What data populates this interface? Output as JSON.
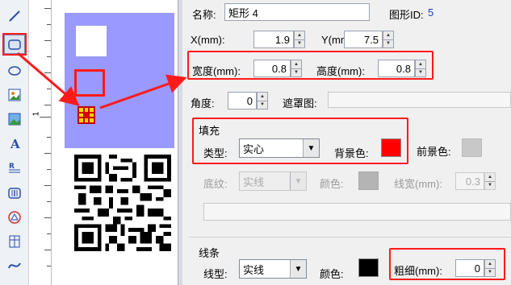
{
  "toolbar": {
    "tools": [
      {
        "icon": "line-icon"
      },
      {
        "icon": "rectangle-icon"
      },
      {
        "icon": "ellipse-icon"
      },
      {
        "icon": "image-icon"
      },
      {
        "icon": "picture-icon"
      },
      {
        "icon": "text-icon"
      },
      {
        "icon": "paragraph-icon"
      },
      {
        "icon": "barcode-icon"
      },
      {
        "icon": "stamp-icon"
      },
      {
        "icon": "table-icon"
      },
      {
        "icon": "curve-icon"
      }
    ]
  },
  "ruler": {
    "mark": "1"
  },
  "properties": {
    "name_label": "名称:",
    "name_value": "矩形 4",
    "id_label": "图形ID:",
    "id_value": "5",
    "x_label": "X(mm):",
    "x_value": "1.9",
    "y_label": "Y(mm):",
    "y_value": "7.5",
    "width_label": "宽度(mm):",
    "width_value": "0.8",
    "height_label": "高度(mm):",
    "height_value": "0.8",
    "angle_label": "角度:",
    "angle_value": "0",
    "mask_label": "遮罩图:",
    "fill": {
      "title": "填充",
      "type_label": "类型:",
      "type_value": "实心",
      "bg_color_label": "背景色:",
      "bg_color": "#ff0000",
      "fg_color_label": "前景色:",
      "fg_color": "#c8c8c8",
      "texture_label": "底纹:",
      "texture_value": "实线",
      "color_label": "颜色:",
      "color": "#b4b4b4",
      "linewidth_label": "线宽(mm):",
      "linewidth_value": "0.3"
    },
    "line": {
      "title": "线条",
      "type_label": "线型:",
      "type_value": "实线",
      "color_label": "颜色:",
      "color": "#000000",
      "thickness_label": "粗细(mm):",
      "thickness_value": "0"
    }
  },
  "colors": {
    "highlight": "#ff1a1a",
    "label_bg": "#9999ff"
  }
}
